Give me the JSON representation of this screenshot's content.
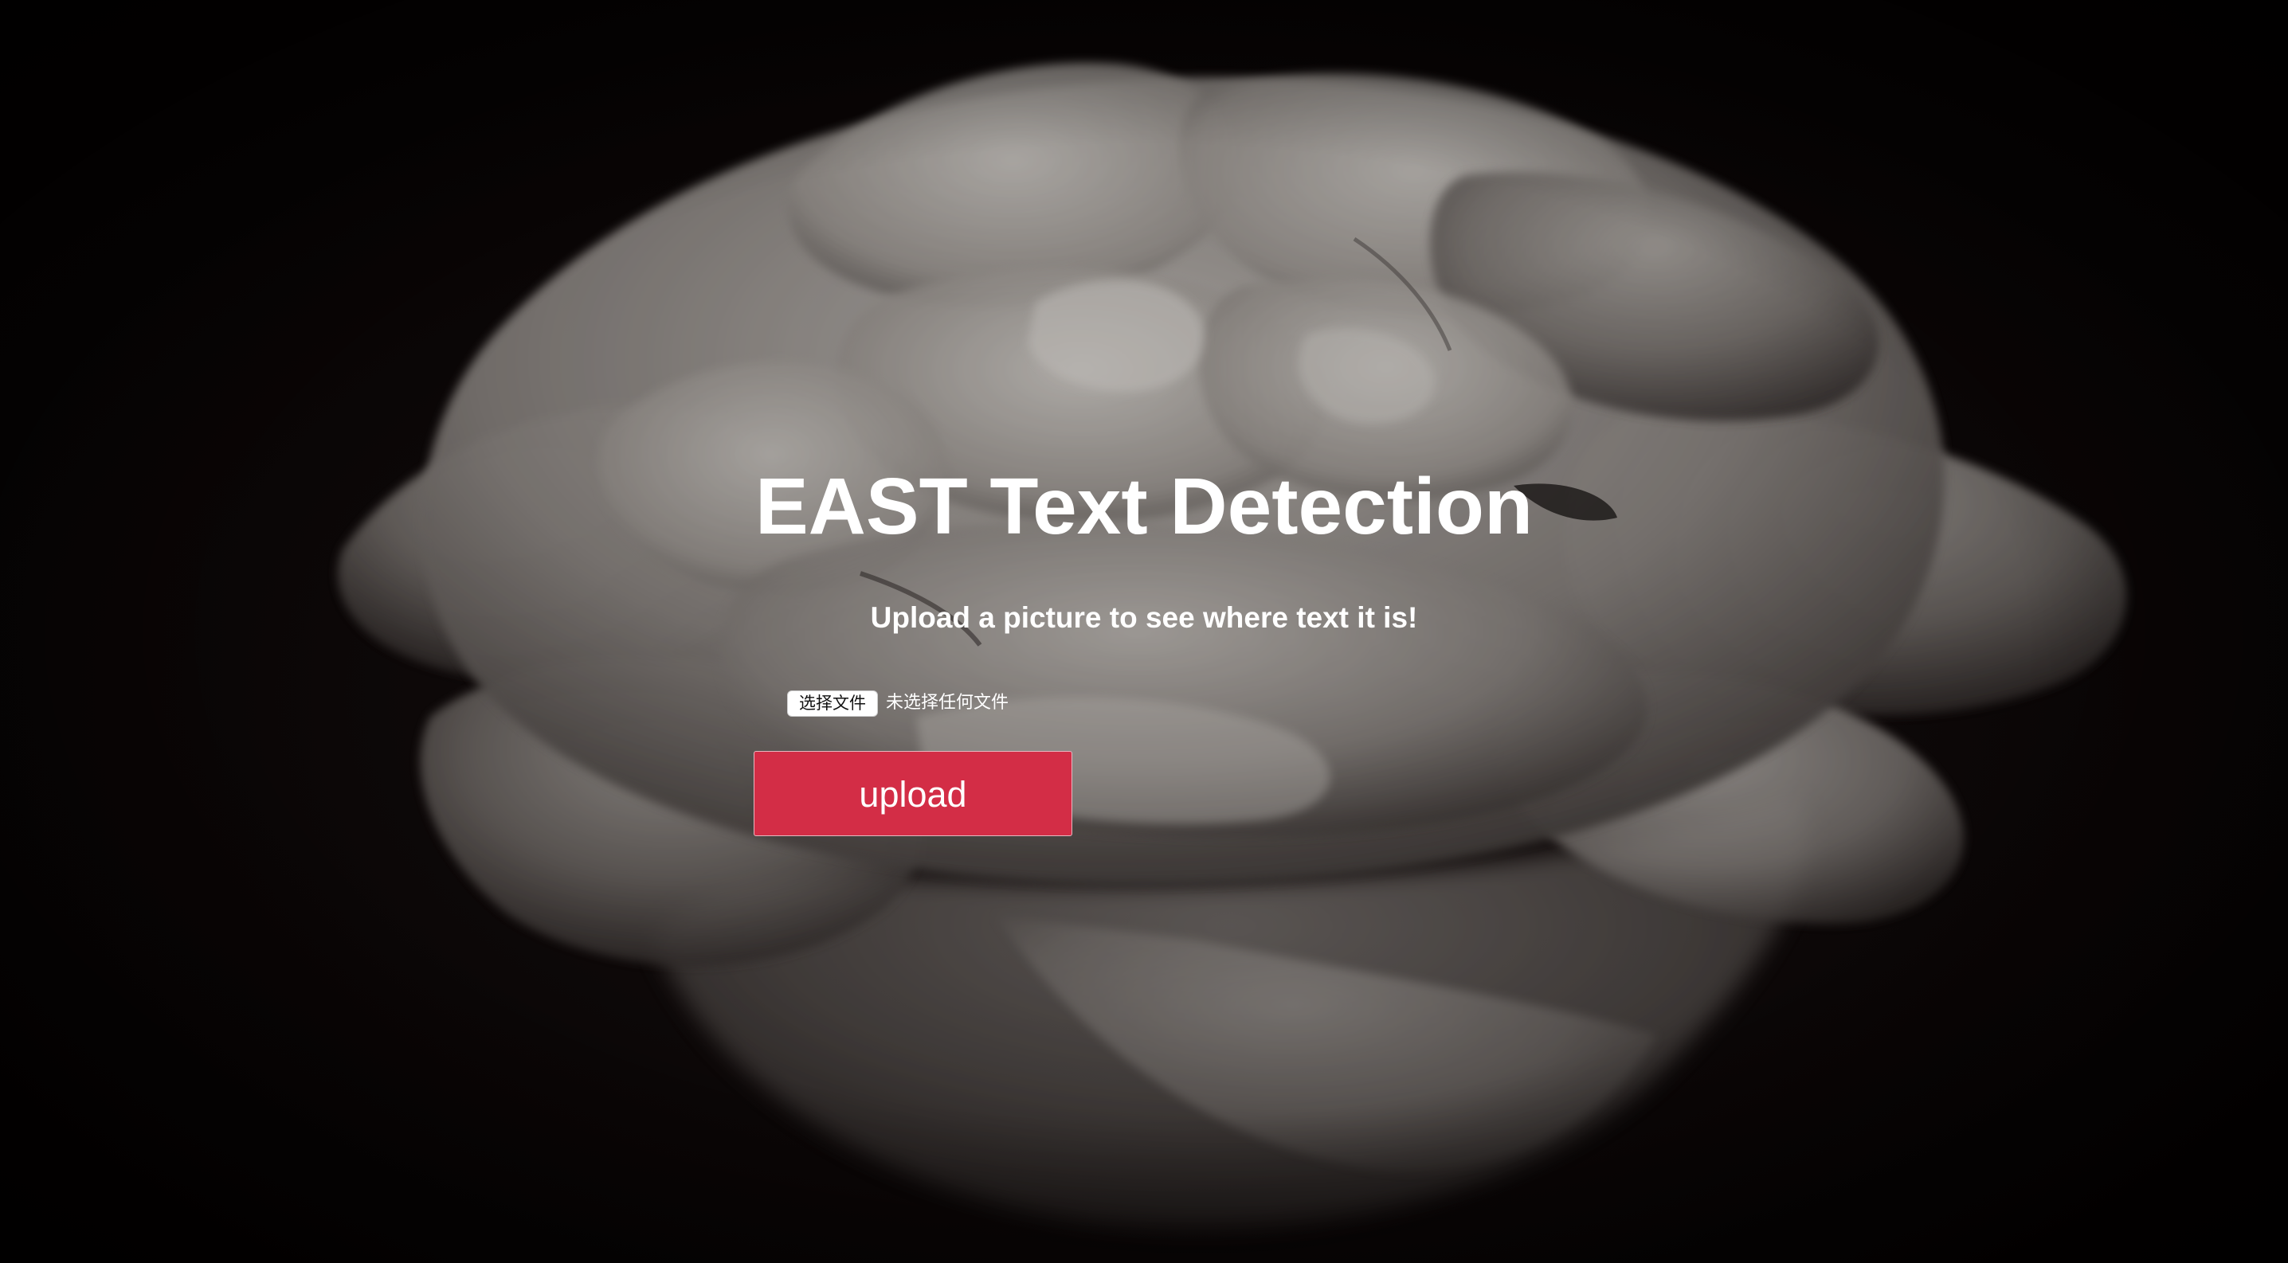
{
  "header": {
    "title": "EAST Text Detection",
    "subtitle": "Upload a picture to see where text it is!"
  },
  "form": {
    "file_button_label": "选择文件",
    "file_status": "未选择任何文件",
    "upload_label": "upload"
  },
  "colors": {
    "background": "#0a0505",
    "upload_button": "#d32d46",
    "text": "#ffffff"
  },
  "background_image": "rose-flower-image"
}
